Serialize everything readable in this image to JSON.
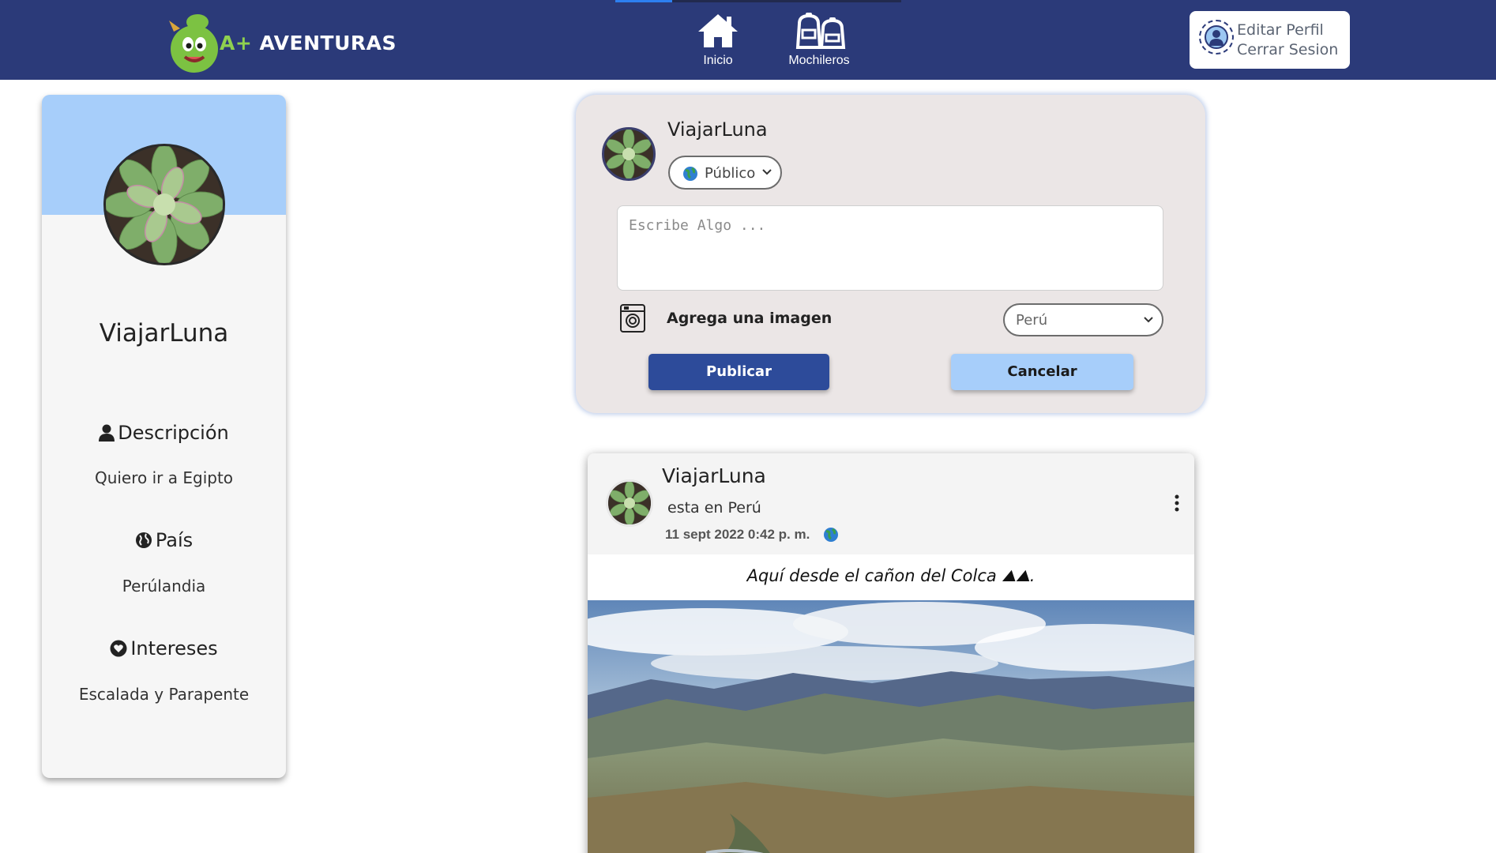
{
  "app": {
    "brand_prefix": "A+",
    "brand_name": "AVENTURAS",
    "accent_color": "#2b3a79",
    "highlight_color": "#a7cefa"
  },
  "nav": {
    "items": [
      {
        "label": "Inicio",
        "icon": "home-icon"
      },
      {
        "label": "Mochileros",
        "icon": "backpackers-icon"
      }
    ]
  },
  "profile_menu": {
    "edit_label": "Editar Perfil",
    "logout_label": "Cerrar Sesion",
    "icon": "user-avatar-icon"
  },
  "profile_card": {
    "name": "ViajarLuna",
    "description_title": "Descripción",
    "description_value": "Quiero ir a Egipto",
    "country_title": "País",
    "country_value": "Perúlandia",
    "interests_title": "Intereses",
    "interests_value": "Escalada y Parapente"
  },
  "composer": {
    "username": "ViajarLuna",
    "privacy_value": "Público",
    "input_placeholder": "Escribe Algo ...",
    "input_value": "",
    "add_image_label": "Agrega una imagen",
    "country_value": "Perú",
    "publish_label": "Publicar",
    "cancel_label": "Cancelar"
  },
  "post": {
    "author": "ViajarLuna",
    "location": "esta en Perú",
    "timestamp": "11 sept 2022 0:42 p. m.",
    "visibility_icon": "globe-icon",
    "text": "Aquí desde el cañon del Colca ⛰⛰."
  }
}
